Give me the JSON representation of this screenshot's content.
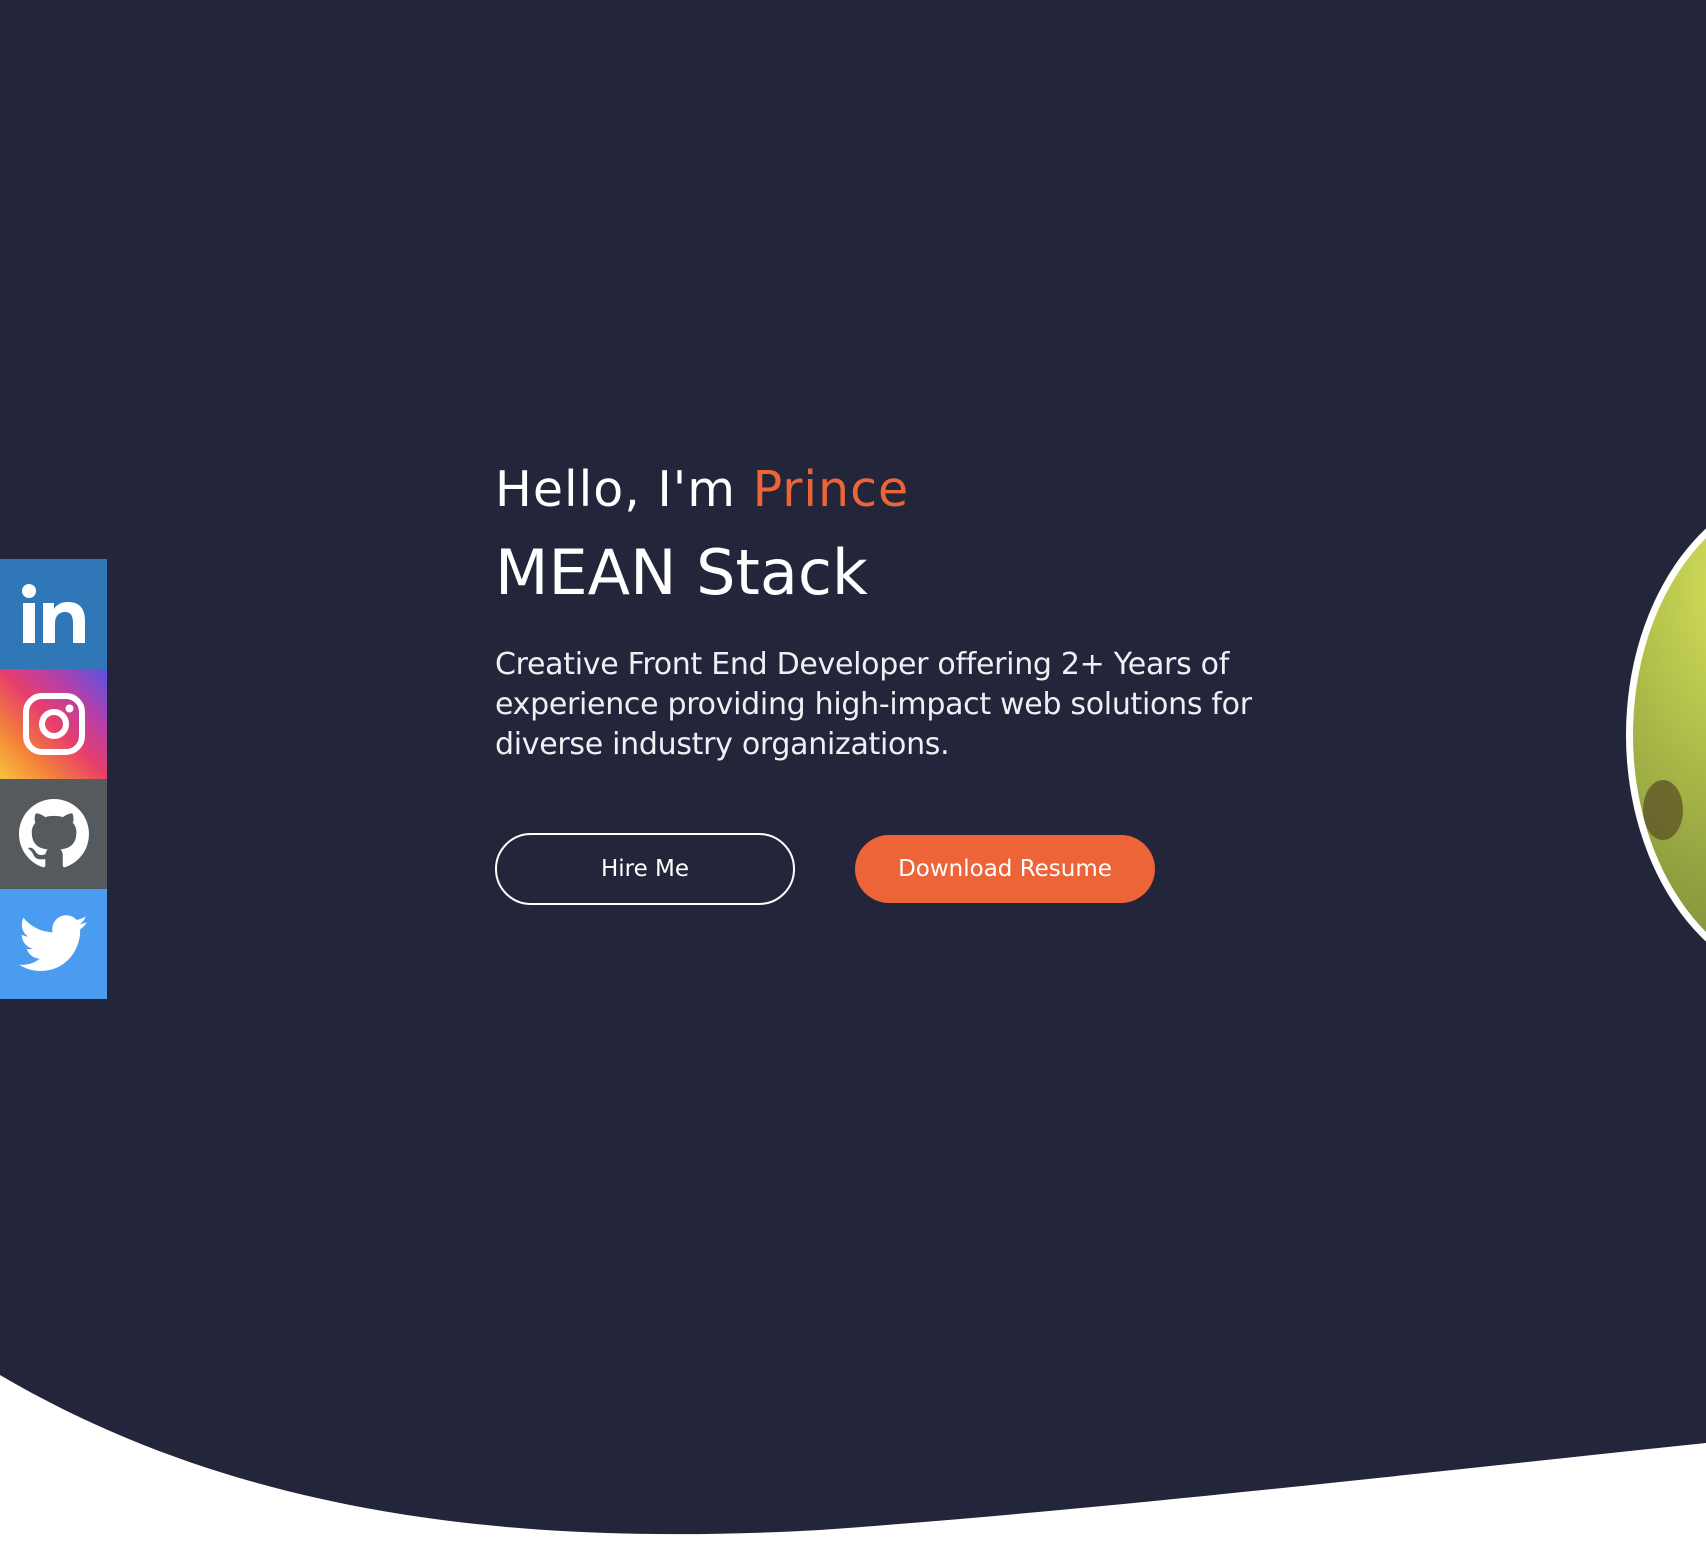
{
  "hero": {
    "greeting_prefix": "Hello, I'm ",
    "name": "Prince",
    "role": "MEAN Stack",
    "description": "Creative Front End Developer offering 2+ Years of experience providing high-impact web solutions for diverse industry organizations."
  },
  "buttons": {
    "hire": "Hire Me",
    "resume": "Download Resume"
  },
  "social": [
    {
      "name": "LinkedIn",
      "icon": "linkedin-icon",
      "color": "#2f77b6"
    },
    {
      "name": "Instagram",
      "icon": "instagram-icon",
      "color": "#e83f6a"
    },
    {
      "name": "GitHub",
      "icon": "github-icon",
      "color": "#555a5f"
    },
    {
      "name": "Twitter",
      "icon": "twitter-icon",
      "color": "#4a9cf0"
    }
  ],
  "colors": {
    "background": "#23263a",
    "accent": "#ec6437",
    "text": "#ffffff"
  }
}
